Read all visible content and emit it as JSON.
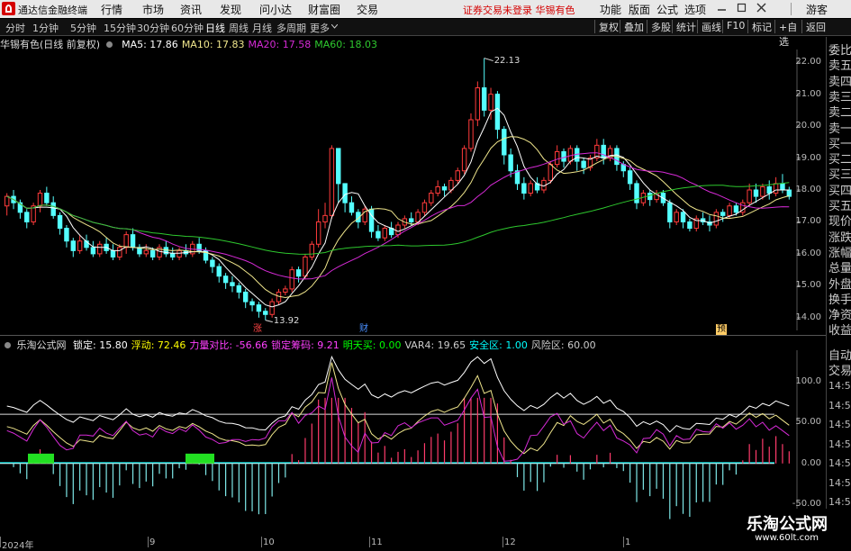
{
  "menu": {
    "app_title": "通达信金融终端",
    "items": [
      "行情",
      "市场",
      "资讯",
      "发现",
      "问小达",
      "财富圈",
      "交易"
    ],
    "warning": "证券交易未登录  华锡有色",
    "right_items": [
      "功能",
      "版面",
      "公式",
      "选项"
    ],
    "guest": "游客"
  },
  "toolbar": {
    "periods": [
      "分时",
      "1分钟",
      "5分钟",
      "15分钟",
      "30分钟",
      "60分钟",
      "日线",
      "周线",
      "月线",
      "多周期",
      "更多"
    ],
    "active_period": "日线",
    "right_buttons": [
      "复权",
      "叠加",
      "多股",
      "统计",
      "画线",
      "F10",
      "标记",
      "+自选",
      "返回"
    ]
  },
  "main_chart": {
    "stock": "华锡有色(日线 前复权)",
    "ma": [
      {
        "label": "MA5: 17.86",
        "color": "#ffffff"
      },
      {
        "label": "MA10: 17.83",
        "color": "#f0e68c"
      },
      {
        "label": "MA20: 17.58",
        "color": "#d62ad6"
      },
      {
        "label": "MA60: 18.03",
        "color": "#2ec82e"
      }
    ],
    "high_label": "22.13",
    "low_label": "13.92",
    "y_ticks": [
      "22.00",
      "21.00",
      "20.00",
      "19.00",
      "18.00",
      "17.00",
      "16.00",
      "15.00",
      "14.00"
    ],
    "markers": [
      {
        "text": "涨",
        "color": "#ff4444"
      },
      {
        "text": "财",
        "color": "#4a90ff"
      },
      {
        "text": "预",
        "color": "#ffcc66"
      }
    ]
  },
  "sub_chart": {
    "name": "乐淘公式网",
    "fields": [
      {
        "label": "锁定: 15.80",
        "color": "#ffffff"
      },
      {
        "label": "浮动: 72.46",
        "color": "#ffff00"
      },
      {
        "label": "力量对比: -56.66",
        "color": "#ff40ff"
      },
      {
        "label": "锁定筹码: 9.21",
        "color": "#ff40ff"
      },
      {
        "label": "明天买: 0.00",
        "color": "#00ff00"
      },
      {
        "label": "VAR4: 19.65",
        "color": "#cccccc"
      },
      {
        "label": "安全区: 1.00",
        "color": "#00ffff"
      },
      {
        "label": "风险区: 60.00",
        "color": "#cccccc"
      }
    ],
    "y_ticks": [
      "100.0",
      "50.00",
      "0.00",
      "-50.00"
    ]
  },
  "x_axis": [
    "2024年",
    "9",
    "10",
    "11",
    "12",
    "1"
  ],
  "right_panel": {
    "items": [
      "委比",
      "卖五",
      "卖四",
      "卖三",
      "卖二",
      "卖一",
      "买一",
      "买二",
      "买三",
      "买四",
      "买五",
      "现价",
      "涨跌",
      "涨幅",
      "总量",
      "外盘",
      "换手",
      "净资",
      "收益"
    ],
    "bottom": [
      "自动",
      "交易"
    ],
    "times": [
      "14:56",
      "14:56",
      "14:56",
      "14:56",
      "14:56",
      "14:56",
      "14:56",
      "14:56"
    ]
  },
  "watermark": {
    "title": "乐淘公式网",
    "url": "www.60lt.com"
  },
  "chart_data": {
    "type": "candlestick",
    "title": "华锡有色(日线 前复权)",
    "x_ticks": [
      "2024年",
      "9",
      "10",
      "11",
      "12",
      "1"
    ],
    "ylim": [
      13.6,
      22.4
    ],
    "candles": [
      [
        17.5,
        17.8,
        17.2,
        17.9
      ],
      [
        17.8,
        17.6,
        17.4,
        18.0
      ],
      [
        17.6,
        17.3,
        17.1,
        17.7
      ],
      [
        17.3,
        17.0,
        16.8,
        17.4
      ],
      [
        17.0,
        17.5,
        16.9,
        17.6
      ],
      [
        17.5,
        17.9,
        17.3,
        18.0
      ],
      [
        17.9,
        17.6,
        17.5,
        18.1
      ],
      [
        17.6,
        17.2,
        17.1,
        17.8
      ],
      [
        17.2,
        16.8,
        16.6,
        17.3
      ],
      [
        16.8,
        16.4,
        16.2,
        16.9
      ],
      [
        16.4,
        16.1,
        15.9,
        16.5
      ],
      [
        16.1,
        16.4,
        16.0,
        16.6
      ],
      [
        16.4,
        16.2,
        16.1,
        16.6
      ],
      [
        16.2,
        16.0,
        15.9,
        16.4
      ],
      [
        16.0,
        16.3,
        15.9,
        16.4
      ],
      [
        16.3,
        16.1,
        16.0,
        16.5
      ],
      [
        16.1,
        15.9,
        15.8,
        16.3
      ],
      [
        15.9,
        16.2,
        15.8,
        16.3
      ],
      [
        16.2,
        16.6,
        16.0,
        16.7
      ],
      [
        16.6,
        16.2,
        16.1,
        16.8
      ],
      [
        16.2,
        16.0,
        15.9,
        16.3
      ],
      [
        16.0,
        16.1,
        15.9,
        16.3
      ],
      [
        16.1,
        15.9,
        15.8,
        16.2
      ],
      [
        15.9,
        16.2,
        15.8,
        16.3
      ],
      [
        16.2,
        16.0,
        15.9,
        16.4
      ],
      [
        16.0,
        15.9,
        15.8,
        16.2
      ],
      [
        15.9,
        16.1,
        15.8,
        16.2
      ],
      [
        16.1,
        16.0,
        15.9,
        16.3
      ],
      [
        16.0,
        16.3,
        15.9,
        16.4
      ],
      [
        16.3,
        16.1,
        16.0,
        16.5
      ],
      [
        16.1,
        15.8,
        15.7,
        16.2
      ],
      [
        15.8,
        15.6,
        15.4,
        15.9
      ],
      [
        15.6,
        15.3,
        15.1,
        15.7
      ],
      [
        15.3,
        15.1,
        14.9,
        15.4
      ],
      [
        15.1,
        15.0,
        14.8,
        15.3
      ],
      [
        15.0,
        14.8,
        14.6,
        15.1
      ],
      [
        14.8,
        14.5,
        14.3,
        14.9
      ],
      [
        14.5,
        14.4,
        14.2,
        14.6
      ],
      [
        14.4,
        14.2,
        14.0,
        14.5
      ],
      [
        14.2,
        14.1,
        13.92,
        14.3
      ],
      [
        14.1,
        14.5,
        14.0,
        14.6
      ],
      [
        14.5,
        14.8,
        14.4,
        14.9
      ],
      [
        14.8,
        14.9,
        14.7,
        15.0
      ],
      [
        14.9,
        15.5,
        14.8,
        15.6
      ],
      [
        15.5,
        15.3,
        15.1,
        15.6
      ],
      [
        15.3,
        15.9,
        15.2,
        16.0
      ],
      [
        15.9,
        16.3,
        15.8,
        16.4
      ],
      [
        16.3,
        17.0,
        16.2,
        17.4
      ],
      [
        17.0,
        17.2,
        16.8,
        17.6
      ],
      [
        17.2,
        19.3,
        17.1,
        19.4
      ],
      [
        19.3,
        18.2,
        17.6,
        19.0
      ],
      [
        18.2,
        17.6,
        17.3,
        18.0
      ],
      [
        17.6,
        17.3,
        17.2,
        17.8
      ],
      [
        17.3,
        17.0,
        16.8,
        17.4
      ],
      [
        17.0,
        17.4,
        16.9,
        17.5
      ],
      [
        17.4,
        16.7,
        16.5,
        17.5
      ],
      [
        16.7,
        16.5,
        16.4,
        16.9
      ],
      [
        16.5,
        16.8,
        16.4,
        16.9
      ],
      [
        16.8,
        16.6,
        16.5,
        17.0
      ],
      [
        16.6,
        16.9,
        16.5,
        17.0
      ],
      [
        16.9,
        17.1,
        16.8,
        17.2
      ],
      [
        17.1,
        17.0,
        16.9,
        17.3
      ],
      [
        17.0,
        17.3,
        16.9,
        17.4
      ],
      [
        17.3,
        17.6,
        17.2,
        17.7
      ],
      [
        17.6,
        17.9,
        17.5,
        18.0
      ],
      [
        17.9,
        18.1,
        17.8,
        18.3
      ],
      [
        18.1,
        18.0,
        17.8,
        18.2
      ],
      [
        18.0,
        18.3,
        17.9,
        18.4
      ],
      [
        18.3,
        18.6,
        18.2,
        18.7
      ],
      [
        18.6,
        19.3,
        18.5,
        19.4
      ],
      [
        19.3,
        20.2,
        19.2,
        20.4
      ],
      [
        20.2,
        21.2,
        20.0,
        21.4
      ],
      [
        21.2,
        20.5,
        20.3,
        22.13
      ],
      [
        20.5,
        21.0,
        20.2,
        21.2
      ],
      [
        21.0,
        19.9,
        19.6,
        21.1
      ],
      [
        19.9,
        19.1,
        18.8,
        20.0
      ],
      [
        19.1,
        18.6,
        18.4,
        19.3
      ],
      [
        18.6,
        18.2,
        18.0,
        18.8
      ],
      [
        18.2,
        17.9,
        17.7,
        18.4
      ],
      [
        17.9,
        18.2,
        17.8,
        18.3
      ],
      [
        18.2,
        18.0,
        17.9,
        18.4
      ],
      [
        18.0,
        18.3,
        17.9,
        18.4
      ],
      [
        18.3,
        18.8,
        18.2,
        18.9
      ],
      [
        18.8,
        19.2,
        18.7,
        19.4
      ],
      [
        19.2,
        18.9,
        18.7,
        19.3
      ],
      [
        18.9,
        19.3,
        18.8,
        19.4
      ],
      [
        19.3,
        18.9,
        18.6,
        19.4
      ],
      [
        18.9,
        18.7,
        18.5,
        19.0
      ],
      [
        18.7,
        19.0,
        18.6,
        19.1
      ],
      [
        19.0,
        19.4,
        18.9,
        19.6
      ],
      [
        19.4,
        19.0,
        18.8,
        19.6
      ],
      [
        19.0,
        19.3,
        18.9,
        19.4
      ],
      [
        19.3,
        18.8,
        18.6,
        19.4
      ],
      [
        18.8,
        18.6,
        18.4,
        18.9
      ],
      [
        18.6,
        18.2,
        18.0,
        18.7
      ],
      [
        18.2,
        17.6,
        17.4,
        18.3
      ],
      [
        17.6,
        17.9,
        17.5,
        18.0
      ],
      [
        17.9,
        17.7,
        17.5,
        18.0
      ],
      [
        17.7,
        17.9,
        17.6,
        18.0
      ],
      [
        17.9,
        17.6,
        17.5,
        18.0
      ],
      [
        17.6,
        17.0,
        16.8,
        17.7
      ],
      [
        17.0,
        17.3,
        16.9,
        17.4
      ],
      [
        17.3,
        17.0,
        16.8,
        17.4
      ],
      [
        17.0,
        16.8,
        16.7,
        17.1
      ],
      [
        16.8,
        17.1,
        16.7,
        17.2
      ],
      [
        17.1,
        17.0,
        16.9,
        17.3
      ],
      [
        17.0,
        16.9,
        16.7,
        17.2
      ],
      [
        16.9,
        17.3,
        16.8,
        17.4
      ],
      [
        17.3,
        17.2,
        17.0,
        17.4
      ],
      [
        17.2,
        17.5,
        17.1,
        17.6
      ],
      [
        17.5,
        17.3,
        17.2,
        17.6
      ],
      [
        17.3,
        17.6,
        17.2,
        17.7
      ],
      [
        17.6,
        18.0,
        17.5,
        18.2
      ],
      [
        18.0,
        17.8,
        17.6,
        18.2
      ],
      [
        17.8,
        18.1,
        17.7,
        18.2
      ],
      [
        18.1,
        17.9,
        17.7,
        18.3
      ],
      [
        17.9,
        18.2,
        17.8,
        18.4
      ],
      [
        18.2,
        18.0,
        17.9,
        18.5
      ],
      [
        18.0,
        17.8,
        17.7,
        18.1
      ]
    ]
  }
}
